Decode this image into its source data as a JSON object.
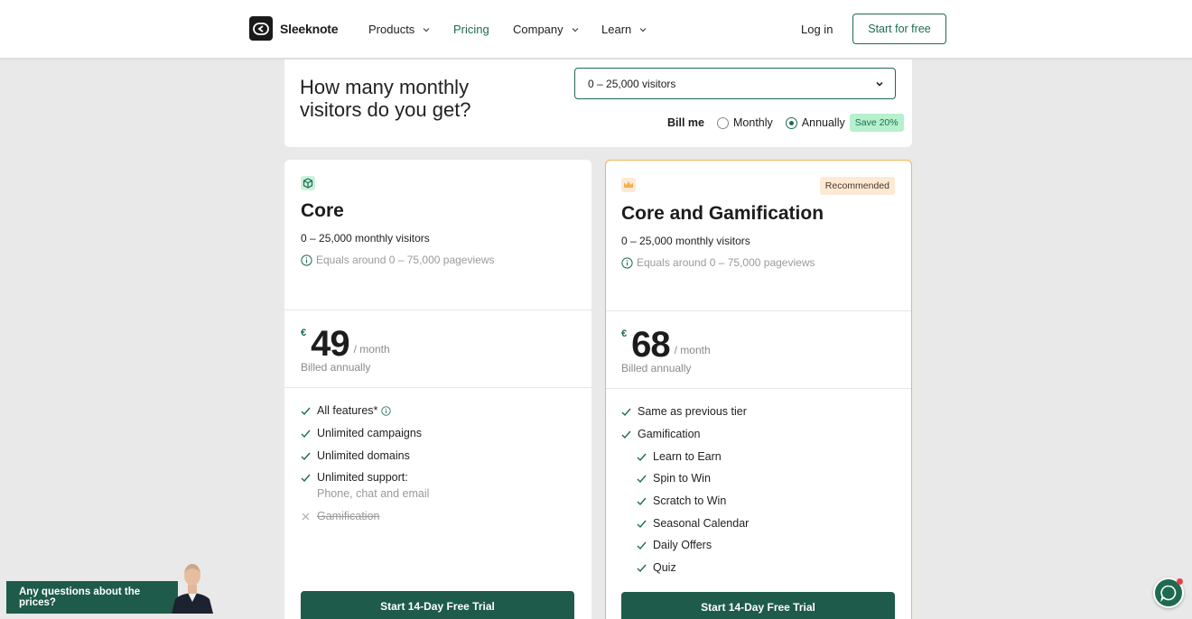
{
  "header": {
    "brand": "Sleeknote",
    "nav": [
      {
        "label": "Products",
        "has_dropdown": true
      },
      {
        "label": "Pricing",
        "has_dropdown": false,
        "active": true
      },
      {
        "label": "Company",
        "has_dropdown": true
      },
      {
        "label": "Learn",
        "has_dropdown": true
      }
    ],
    "login": "Log in",
    "cta": "Start for free"
  },
  "visitors": {
    "question_line1": "How many monthly",
    "question_line2": "visitors do you get?",
    "selected": "0 – 25,000 visitors",
    "bill_label": "Bill me",
    "option_monthly": "Monthly",
    "option_annually": "Annually",
    "selected_billing": "Annually",
    "save_badge": "Save 20%"
  },
  "plans": {
    "core": {
      "icon": "cube-icon",
      "title": "Core",
      "visitors": "0 – 25,000 monthly visitors",
      "pageviews": "Equals around 0 – 75,000 pageviews",
      "currency": "€",
      "price": "49",
      "per": "/ month",
      "billed": "Billed annually",
      "features": [
        "All features*",
        "Unlimited campaigns",
        "Unlimited domains",
        "Unlimited support:"
      ],
      "support_sub": "Phone, chat and email",
      "excluded": "Gamification",
      "cta": "Start 14-Day Free Trial"
    },
    "gamification": {
      "icon": "crown-icon",
      "badge": "Recommended",
      "title": "Core and Gamification",
      "visitors": "0 – 25,000 monthly visitors",
      "pageviews": "Equals around 0 – 75,000 pageviews",
      "currency": "€",
      "price": "68",
      "per": "/ month",
      "billed": "Billed annually",
      "features": [
        "Same as previous tier",
        "Gamification"
      ],
      "sub_features": [
        "Learn to Earn",
        "Spin to Win",
        "Scratch to Win",
        "Seasonal Calendar",
        "Daily Offers",
        "Quiz"
      ],
      "cta": "Start 14-Day Free Trial"
    }
  },
  "widget": {
    "questions": "Any questions about the prices?"
  },
  "colors": {
    "accent": "#1e6b52",
    "button": "#1e5b4a",
    "recommended_border": "#f0b45c",
    "save_badge_bg": "#b6f0cd"
  }
}
